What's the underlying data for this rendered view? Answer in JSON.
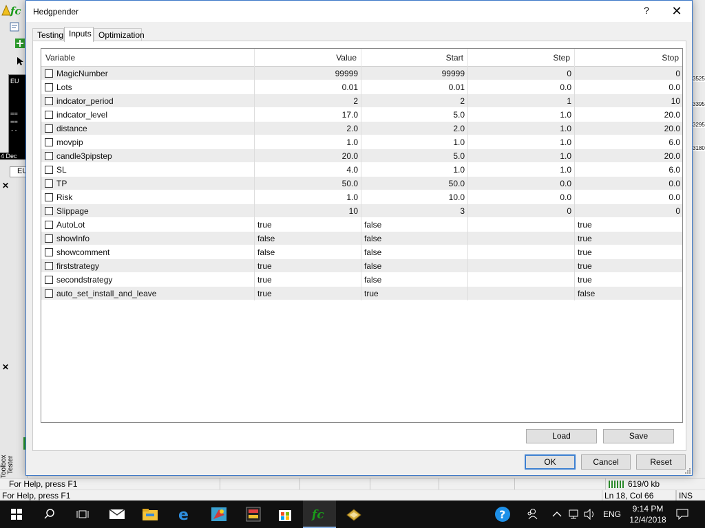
{
  "dialog": {
    "title": "Hedgpender",
    "help_glyph": "?",
    "close_glyph": "✕",
    "tabs": [
      {
        "label": "Testing",
        "active": false
      },
      {
        "label": "Inputs",
        "active": true
      },
      {
        "label": "Optimization",
        "active": false
      }
    ],
    "columns": [
      "Variable",
      "Value",
      "Start",
      "Step",
      "Stop"
    ],
    "rows": [
      {
        "name": "MagicNumber",
        "value": "99999",
        "start": "99999",
        "step": "0",
        "stop": "0",
        "numeric": true
      },
      {
        "name": "Lots",
        "value": "0.01",
        "start": "0.01",
        "step": "0.0",
        "stop": "0.0",
        "numeric": true
      },
      {
        "name": "indcator_period",
        "value": "2",
        "start": "2",
        "step": "1",
        "stop": "10",
        "numeric": true
      },
      {
        "name": "indcator_level",
        "value": "17.0",
        "start": "5.0",
        "step": "1.0",
        "stop": "20.0",
        "numeric": true
      },
      {
        "name": "distance",
        "value": "2.0",
        "start": "2.0",
        "step": "1.0",
        "stop": "20.0",
        "numeric": true
      },
      {
        "name": "movpip",
        "value": "1.0",
        "start": "1.0",
        "step": "1.0",
        "stop": "6.0",
        "numeric": true
      },
      {
        "name": "candle3pipstep",
        "value": "20.0",
        "start": "5.0",
        "step": "1.0",
        "stop": "20.0",
        "numeric": true
      },
      {
        "name": "SL",
        "value": "4.0",
        "start": "1.0",
        "step": "1.0",
        "stop": "6.0",
        "numeric": true
      },
      {
        "name": "TP",
        "value": "50.0",
        "start": "50.0",
        "step": "0.0",
        "stop": "0.0",
        "numeric": true
      },
      {
        "name": "Risk",
        "value": "1.0",
        "start": "10.0",
        "step": "0.0",
        "stop": "0.0",
        "numeric": true
      },
      {
        "name": "Slippage",
        "value": "10",
        "start": "3",
        "step": "0",
        "stop": "0",
        "numeric": true
      },
      {
        "name": "AutoLot",
        "value": "true",
        "start": "false",
        "step": "",
        "stop": "true",
        "numeric": false
      },
      {
        "name": "showInfo",
        "value": "false",
        "start": "false",
        "step": "",
        "stop": "true",
        "numeric": false
      },
      {
        "name": "showcomment",
        "value": "false",
        "start": "false",
        "step": "",
        "stop": "true",
        "numeric": false
      },
      {
        "name": "firststrategy",
        "value": "true",
        "start": "false",
        "step": "",
        "stop": "true",
        "numeric": false
      },
      {
        "name": "secondstrategy",
        "value": "true",
        "start": "false",
        "step": "",
        "stop": "true",
        "numeric": false
      },
      {
        "name": "auto_set_install_and_leave",
        "value": "true",
        "start": "true",
        "step": "",
        "stop": "false",
        "numeric": false
      }
    ],
    "buttons": {
      "load": "Load",
      "save": "Save",
      "ok": "OK",
      "cancel": "Cancel",
      "reset": "Reset"
    }
  },
  "background": {
    "chart_label": "EU",
    "date_label": "4 Dec",
    "tab_label": "EU",
    "tester_label": "Tester",
    "toolbox_label": "Toolbox",
    "right_prices": [
      "3525",
      "3395",
      "3295",
      "3180"
    ]
  },
  "status_bar": {
    "help_text": "For Help, press F1",
    "help_text_2": "For Help, press F1",
    "traffic": "619/0 kb",
    "position": "Ln 18, Col 66",
    "mode": "INS"
  },
  "taskbar": {
    "language": "ENG",
    "time": "9:14 PM",
    "date": "12/4/2018"
  },
  "colors": {
    "accent": "#3c7fd1",
    "row_alt": "#ececec",
    "taskbar": "#101010",
    "logo_green": "#1a9a1a"
  }
}
